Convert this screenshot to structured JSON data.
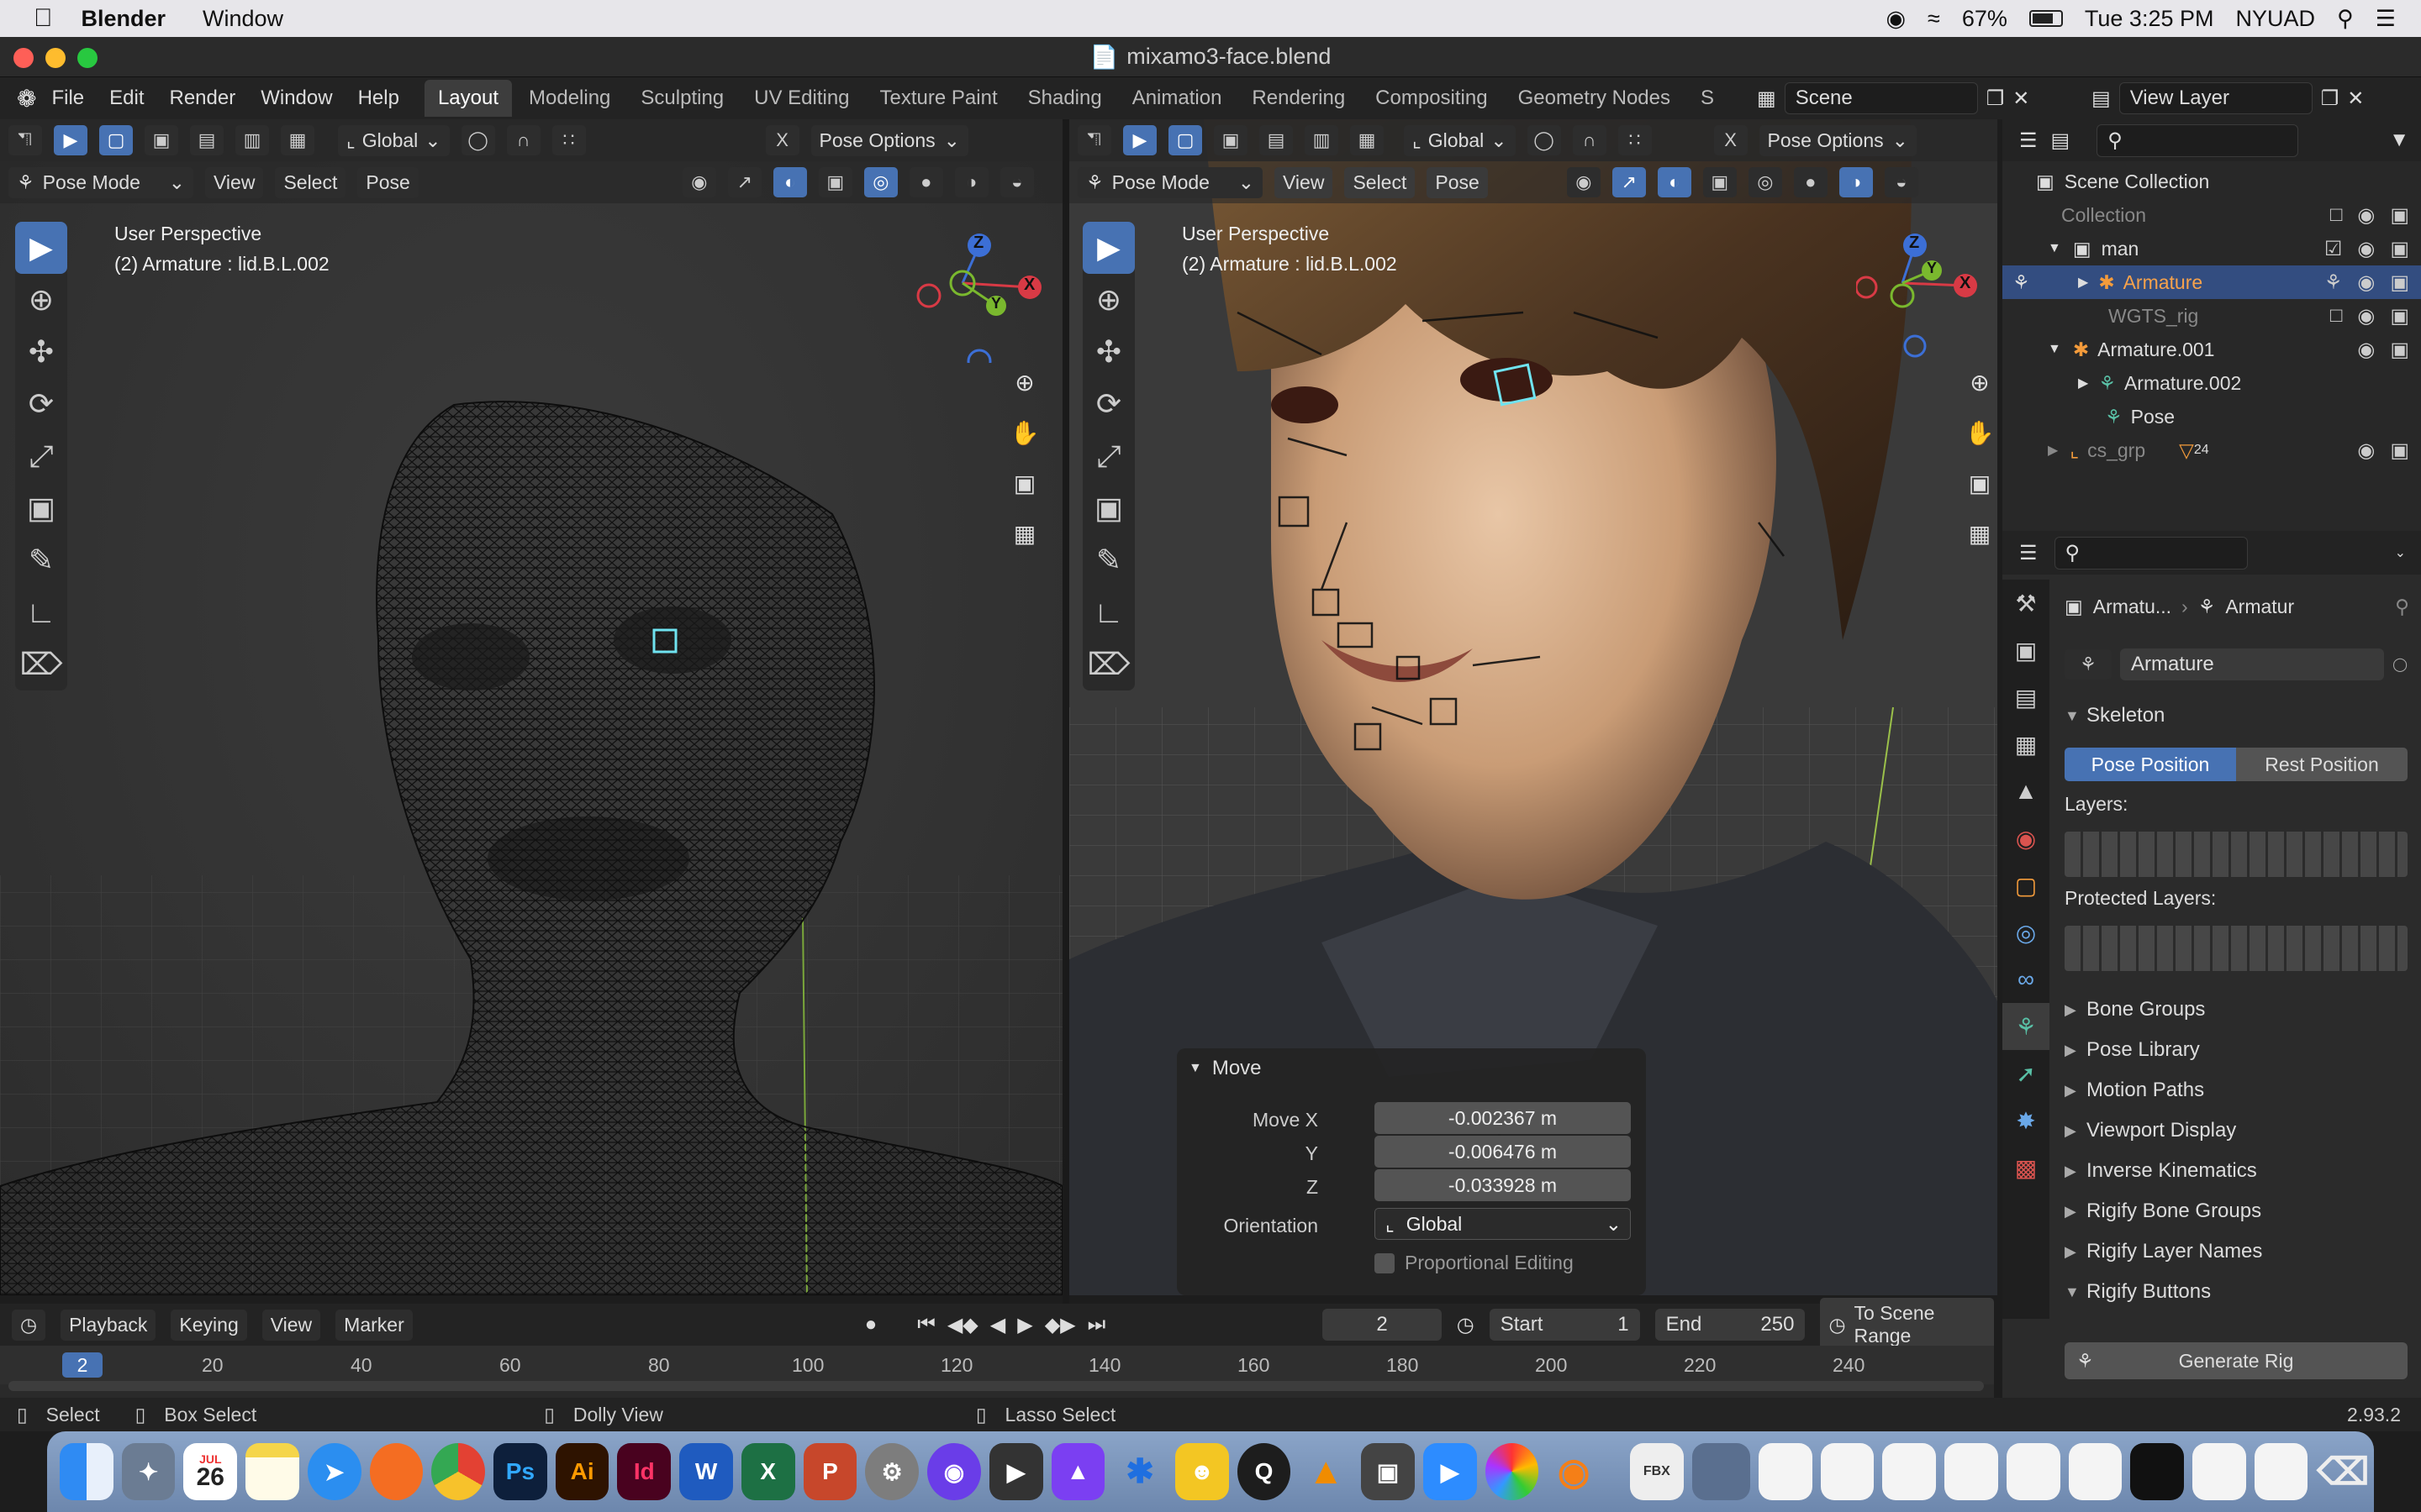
{
  "menubar": {
    "app_name": "Blender",
    "items": [
      "Window"
    ],
    "battery": "67%",
    "clock": "Tue 3:25 PM",
    "user": "NYUAD"
  },
  "window": {
    "title": "mixamo3-face.blend"
  },
  "topbar": {
    "menus": [
      "File",
      "Edit",
      "Render",
      "Window",
      "Help"
    ],
    "workspaces": [
      "Layout",
      "Modeling",
      "Sculpting",
      "UV Editing",
      "Texture Paint",
      "Shading",
      "Animation",
      "Rendering",
      "Compositing",
      "Geometry Nodes",
      "S"
    ],
    "active_workspace": "Layout",
    "scene": "Scene",
    "view_layer": "View Layer"
  },
  "viewport_left": {
    "transform": "Global",
    "pose_options": "Pose Options",
    "mode": "Pose Mode",
    "menus": [
      "View",
      "Select",
      "Pose"
    ],
    "perspective": "User Perspective",
    "object_info": "(2) Armature : lid.B.L.002",
    "axis_labels": {
      "z": "Z",
      "y": "Y",
      "x": "X"
    }
  },
  "viewport_right": {
    "transform": "Global",
    "pose_options": "Pose Options",
    "mode": "Pose Mode",
    "menus": [
      "View",
      "Select",
      "Pose"
    ],
    "perspective": "User Perspective",
    "object_info": "(2) Armature : lid.B.L.002",
    "axis_labels": {
      "z": "Z",
      "y": "Y",
      "x": "X"
    }
  },
  "move_panel": {
    "title": "Move",
    "x_label": "Move X",
    "x_value": "-0.002367 m",
    "y_label": "Y",
    "y_value": "-0.006476 m",
    "z_label": "Z",
    "z_value": "-0.033928 m",
    "orientation_label": "Orientation",
    "orientation_value": "Global",
    "proportional_label": "Proportional Editing"
  },
  "outliner": {
    "root": "Scene Collection",
    "rows": [
      "Collection",
      "man",
      "Armature",
      "WGTS_rig",
      "Armature.001",
      "Armature.002",
      "Pose",
      "cs_grp"
    ],
    "badge": "24"
  },
  "properties": {
    "object_name": "Armatu...",
    "data_name": "Armatur",
    "datablock": "Armature",
    "skeleton": "Skeleton",
    "pose_position": "Pose Position",
    "rest_position": "Rest Position",
    "layers_label": "Layers:",
    "protected_label": "Protected Layers:",
    "panels": [
      "Bone Groups",
      "Pose Library",
      "Motion Paths",
      "Viewport Display",
      "Inverse Kinematics",
      "Rigify Bone Groups",
      "Rigify Layer Names",
      "Rigify Buttons"
    ],
    "generate": "Generate Rig"
  },
  "timeline": {
    "menus": [
      "Playback",
      "Keying",
      "View",
      "Marker"
    ],
    "current_frame": "2",
    "start_label": "Start",
    "start": "1",
    "end_label": "End",
    "end": "250",
    "scene_range": "To Scene Range",
    "ticks": [
      "20",
      "40",
      "60",
      "80",
      "100",
      "120",
      "140",
      "160",
      "180",
      "200",
      "220",
      "240"
    ]
  },
  "statusbar": {
    "items": [
      "Select",
      "Box Select",
      "Dolly View",
      "Lasso Select"
    ],
    "version": "2.93.2"
  },
  "dock": {
    "calendar_month": "JUL",
    "calendar_day": "26",
    "apps": [
      "Ps",
      "Ai",
      "Id"
    ]
  }
}
